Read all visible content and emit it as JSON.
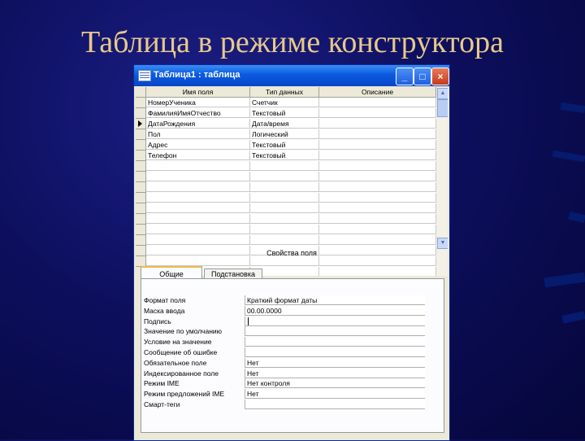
{
  "slide": {
    "title": "Таблица в режиме конструктора"
  },
  "window": {
    "title": "Таблица1 : таблица",
    "min": "_",
    "max": "□",
    "close": "×"
  },
  "grid": {
    "headers": [
      "Имя поля",
      "Тип данных",
      "Описание"
    ],
    "rows": [
      [
        "НомерУченика",
        "Счетчик",
        ""
      ],
      [
        "ФамилияИмяОтчество",
        "Текстовый",
        ""
      ],
      [
        "ДатаРождения",
        "Дата/время",
        ""
      ],
      [
        "Пол",
        "Логический",
        ""
      ],
      [
        "Адрес",
        "Текстовый",
        ""
      ],
      [
        "Телефон",
        "Текстовый",
        ""
      ]
    ],
    "current_row": 2,
    "up_arrow": "▲",
    "down_arrow": "▼"
  },
  "properties": {
    "label": "Свойства поля",
    "tabs": [
      "Общие",
      "Подстановка"
    ],
    "fields": [
      {
        "label": "Формат поля",
        "value": "Краткий формат даты"
      },
      {
        "label": "Маска ввода",
        "value": "00.00.0000"
      },
      {
        "label": "Подпись",
        "value": ""
      },
      {
        "label": "Значение по умолчанию",
        "value": ""
      },
      {
        "label": "Условие на значение",
        "value": ""
      },
      {
        "label": "Сообщение об ошибке",
        "value": ""
      },
      {
        "label": "Обязательное поле",
        "value": "Нет"
      },
      {
        "label": "Индексированное поле",
        "value": "Нет"
      },
      {
        "label": "Режим IME",
        "value": "Нет контроля"
      },
      {
        "label": "Режим предложений IME",
        "value": "Нет"
      },
      {
        "label": "Смарт-теги",
        "value": ""
      }
    ]
  }
}
